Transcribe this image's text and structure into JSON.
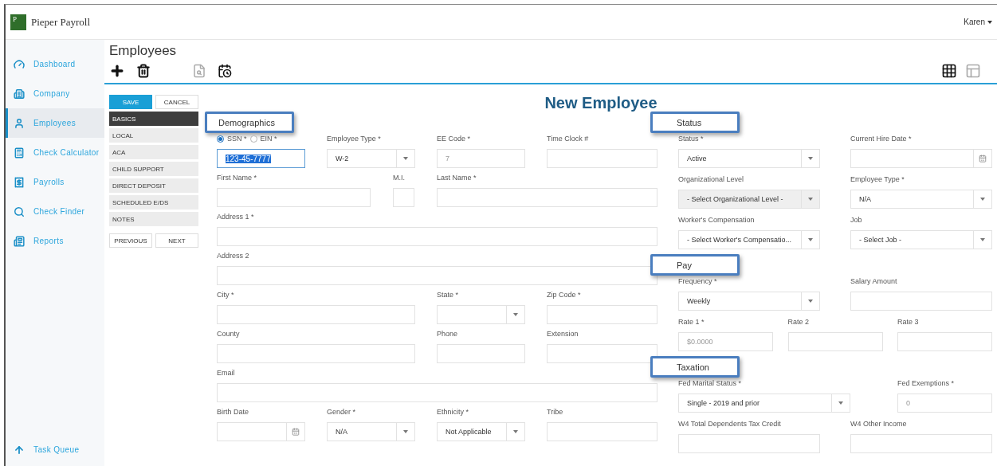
{
  "app": {
    "logo_letter": "P",
    "name": "Pieper Payroll",
    "user": "Karen"
  },
  "sidebar": {
    "items": [
      {
        "label": "Dashboard",
        "selected": false
      },
      {
        "label": "Company",
        "selected": false
      },
      {
        "label": "Employees",
        "selected": true
      },
      {
        "label": "Check Calculator",
        "selected": false
      },
      {
        "label": "Payrolls",
        "selected": false
      },
      {
        "label": "Check Finder",
        "selected": false
      },
      {
        "label": "Reports",
        "selected": false
      }
    ],
    "footer_item": "Task Queue"
  },
  "page": {
    "title": "Employees"
  },
  "subnav": {
    "save": "SAVE",
    "cancel": "CANCEL",
    "tabs": [
      {
        "label": "BASICS",
        "selected": true
      },
      {
        "label": "LOCAL",
        "selected": false
      },
      {
        "label": "ACA",
        "selected": false
      },
      {
        "label": "CHILD SUPPORT",
        "selected": false
      },
      {
        "label": "DIRECT DEPOSIT",
        "selected": false
      },
      {
        "label": "SCHEDULED E/DS",
        "selected": false
      },
      {
        "label": "NOTES",
        "selected": false
      }
    ],
    "previous": "PREVIOUS",
    "next": "NEXT"
  },
  "form": {
    "title": "New Employee",
    "left": {
      "section": "Demographics",
      "rows": [
        {
          "kind": "quad",
          "fields": [
            {
              "kind": "text",
              "options": [
                {
                  "label": "SSN *",
                  "selected": true
                },
                {
                  "label": "EIN *",
                  "selected": false
                }
              ],
              "value": "123-45-7777",
              "focused": true,
              "disabled": false
            },
            {
              "kind": "select",
              "label": "Employee Type *",
              "value": "W-2",
              "focused": false,
              "disabled": false
            },
            {
              "kind": "text",
              "label": "EE Code *",
              "placeholder": "7",
              "focused": false,
              "disabled": false
            },
            {
              "kind": "text",
              "label": "Time Clock #",
              "focused": false,
              "disabled": false
            }
          ]
        },
        {
          "kind": "name",
          "fields": [
            {
              "kind": "text",
              "label": "First Name *",
              "focused": false,
              "disabled": false
            },
            {
              "kind": "text",
              "label": "M.I.",
              "focused": false,
              "disabled": false
            },
            {
              "kind": "text",
              "label": "Last Name *",
              "focused": false,
              "disabled": false
            }
          ]
        },
        {
          "kind": "full",
          "fields": [
            {
              "kind": "text",
              "label": "Address 1 *",
              "focused": false,
              "disabled": false
            }
          ]
        },
        {
          "kind": "full",
          "fields": [
            {
              "kind": "text",
              "label": "Address 2",
              "focused": false,
              "disabled": false
            }
          ]
        },
        {
          "kind": "city",
          "fields": [
            {
              "kind": "text",
              "label": "City *",
              "focused": false,
              "disabled": false
            },
            {
              "kind": "select",
              "label": "State *",
              "focused": false,
              "disabled": false
            },
            {
              "kind": "text",
              "label": "Zip Code *",
              "focused": false,
              "disabled": false
            }
          ]
        },
        {
          "kind": "city",
          "fields": [
            {
              "kind": "text",
              "label": "County",
              "focused": false,
              "disabled": false
            },
            {
              "kind": "text",
              "label": "Phone",
              "focused": false,
              "disabled": false
            },
            {
              "kind": "text",
              "label": "Extension",
              "focused": false,
              "disabled": false
            }
          ]
        },
        {
          "kind": "full",
          "fields": [
            {
              "kind": "text",
              "label": "Email",
              "focused": false,
              "disabled": false
            }
          ]
        },
        {
          "kind": "quad",
          "fields": [
            {
              "kind": "date",
              "label": "Birth Date",
              "focused": false,
              "disabled": false
            },
            {
              "kind": "select",
              "label": "Gender *",
              "value": "N/A",
              "focused": false,
              "disabled": false
            },
            {
              "kind": "select",
              "label": "Ethnicity *",
              "value": "Not Applicable",
              "focused": false,
              "disabled": false
            },
            {
              "kind": "text",
              "label": "Tribe",
              "focused": false,
              "disabled": false
            }
          ]
        }
      ]
    },
    "right": {
      "sections": [
        {
          "title": "Status",
          "rows": [
            {
              "kind": "pair",
              "fields": [
                {
                  "kind": "select",
                  "label": "Status *",
                  "value": "Active",
                  "focused": false,
                  "disabled": false
                },
                {
                  "kind": "date",
                  "label": "Current Hire Date *",
                  "focused": false,
                  "disabled": false
                }
              ]
            },
            {
              "kind": "pair",
              "fields": [
                {
                  "kind": "select",
                  "label": "Organizational Level",
                  "value": "- Select Organizational Level -",
                  "focused": false,
                  "disabled": true
                },
                {
                  "kind": "select",
                  "label": "Employee Type *",
                  "value": "N/A",
                  "focused": false,
                  "disabled": false
                }
              ]
            },
            {
              "kind": "pair",
              "fields": [
                {
                  "kind": "select",
                  "label": "Worker's Compensation",
                  "value": "- Select Worker's Compensatio...",
                  "focused": false,
                  "disabled": false
                },
                {
                  "kind": "select",
                  "label": "Job",
                  "value": "- Select Job -",
                  "focused": false,
                  "disabled": false
                }
              ]
            }
          ]
        },
        {
          "title": "Pay",
          "rows": [
            {
              "kind": "pair",
              "fields": [
                {
                  "kind": "select",
                  "label": "Frequency *",
                  "value": "Weekly",
                  "focused": false,
                  "disabled": false
                },
                {
                  "kind": "text",
                  "label": "Salary Amount",
                  "focused": false,
                  "disabled": false
                }
              ]
            },
            {
              "kind": "triple",
              "fields": [
                {
                  "kind": "text",
                  "label": "Rate 1 *",
                  "placeholder": "$0.0000",
                  "focused": false,
                  "disabled": false
                },
                {
                  "kind": "text",
                  "label": "Rate 2",
                  "focused": false,
                  "disabled": false
                },
                {
                  "kind": "text",
                  "label": "Rate 3",
                  "focused": false,
                  "disabled": false
                }
              ]
            }
          ]
        },
        {
          "title": "Taxation",
          "rows": [
            {
              "kind": "tax",
              "fields": [
                {
                  "kind": "select",
                  "label": "Fed Marital Status *",
                  "value": "Single - 2019 and prior",
                  "focused": false,
                  "disabled": false
                },
                {
                  "kind": "text",
                  "label": "Fed Exemptions *",
                  "placeholder": "0",
                  "focused": false,
                  "disabled": false
                }
              ]
            },
            {
              "kind": "pair",
              "fields": [
                {
                  "kind": "text",
                  "label": "W4 Total Dependents Tax Credit",
                  "focused": false,
                  "disabled": false
                },
                {
                  "kind": "text",
                  "label": "W4 Other Income",
                  "focused": false,
                  "disabled": false
                }
              ]
            }
          ]
        }
      ]
    }
  }
}
